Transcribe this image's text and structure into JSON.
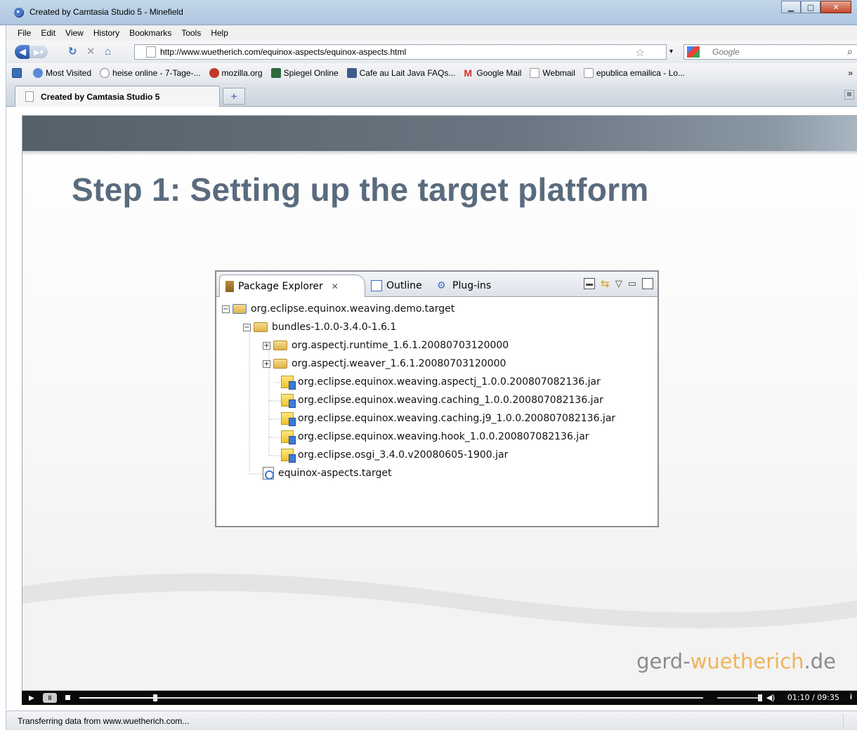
{
  "window": {
    "title": "Created by Camtasia Studio 5 - Minefield"
  },
  "menu": [
    "File",
    "Edit",
    "View",
    "History",
    "Bookmarks",
    "Tools",
    "Help"
  ],
  "nav": {
    "url": "http://www.wuetherich.com/equinox-aspects/equinox-aspects.html",
    "search_placeholder": "Google"
  },
  "bookmarks": [
    {
      "label": "Most Visited",
      "icon": "bookmark-blue-icon",
      "color": "#5a8ad6"
    },
    {
      "label": "heise online - 7-Tage-...",
      "icon": "heise-icon",
      "color": "#888888"
    },
    {
      "label": "mozilla.org",
      "icon": "mozilla-icon",
      "color": "#c0392b"
    },
    {
      "label": "Spiegel Online",
      "icon": "spiegel-icon",
      "color": "#2d6a3c"
    },
    {
      "label": "Cafe au Lait Java FAQs...",
      "icon": "cafe-au-lait-icon",
      "color": "#3d5a8a"
    },
    {
      "label": "Google Mail",
      "icon": "gmail-icon",
      "color": "#d93025"
    },
    {
      "label": "Webmail",
      "icon": "page-icon",
      "color": "#ffffff"
    },
    {
      "label": "epublica emailica - Lo...",
      "icon": "page-icon",
      "color": "#ffffff"
    }
  ],
  "tabs": {
    "active_label": "Created by Camtasia Studio 5"
  },
  "slide": {
    "title": "Step 1: Setting up the target platform",
    "brand_prefix": "gerd-",
    "brand_highlight": "wuetherich",
    "brand_suffix": ".de"
  },
  "eclipse": {
    "tabs": [
      "Package Explorer",
      "Outline",
      "Plug-ins"
    ],
    "tree": [
      {
        "label": "org.eclipse.equinox.weaving.demo.target",
        "kind": "project",
        "toggle": "⊟"
      },
      {
        "label": "bundles-1.0.0-3.4.0-1.6.1",
        "kind": "folder",
        "toggle": "⊟"
      },
      {
        "label": "org.aspectj.runtime_1.6.1.20080703120000",
        "kind": "folder",
        "toggle": "⊞"
      },
      {
        "label": "org.aspectj.weaver_1.6.1.20080703120000",
        "kind": "folder",
        "toggle": "⊞"
      },
      {
        "label": "org.eclipse.equinox.weaving.aspectj_1.0.0.200807082136.jar",
        "kind": "jar"
      },
      {
        "label": "org.eclipse.equinox.weaving.caching_1.0.0.200807082136.jar",
        "kind": "jar"
      },
      {
        "label": "org.eclipse.equinox.weaving.caching.j9_1.0.0.200807082136.jar",
        "kind": "jar"
      },
      {
        "label": "org.eclipse.equinox.weaving.hook_1.0.0.200807082136.jar",
        "kind": "jar"
      },
      {
        "label": "org.eclipse.osgi_3.4.0.v20080605-1900.jar",
        "kind": "jar"
      },
      {
        "label": "equinox-aspects.target",
        "kind": "target"
      }
    ]
  },
  "player": {
    "time": "01:10 / 09:35",
    "progress": 0.122,
    "volume": 1.0
  },
  "status": {
    "text": "Transferring data from www.wuetherich.com..."
  },
  "colors": {
    "slide_title": "#5a6b7d",
    "brand_highlight": "#f0b35a",
    "brand": "#8b8b8b"
  }
}
